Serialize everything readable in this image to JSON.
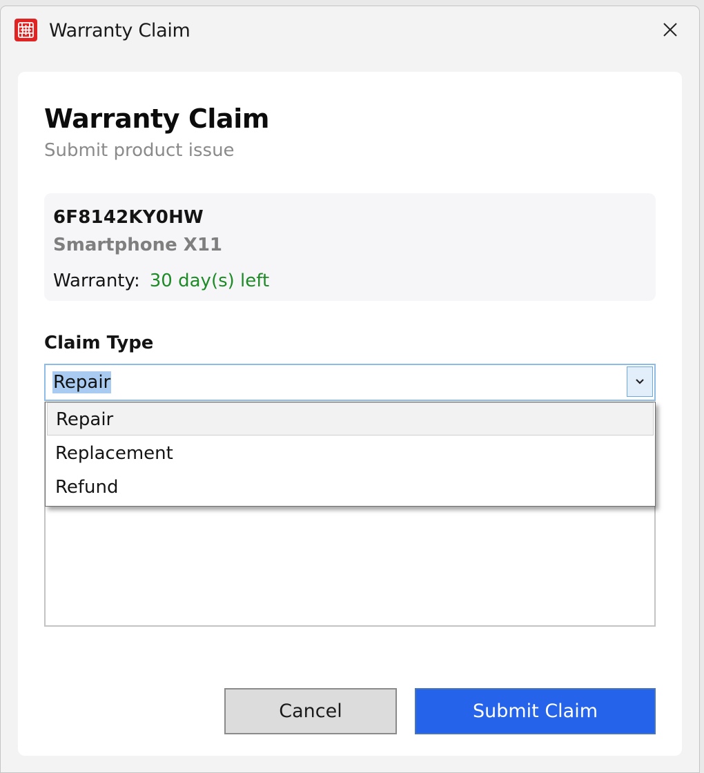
{
  "window": {
    "title": "Warranty Claim",
    "icon": "app-logo-icon",
    "close_icon": "close-icon"
  },
  "form": {
    "heading": "Warranty Claim",
    "subheading": "Submit product issue"
  },
  "product": {
    "serial": "6F8142KY0HW",
    "model": "Smartphone X11",
    "warranty_label": "Warranty:",
    "warranty_value": "30 day(s) left"
  },
  "claim": {
    "label": "Claim Type",
    "selected": "Repair",
    "options": [
      "Repair",
      "Replacement",
      "Refund"
    ]
  },
  "buttons": {
    "cancel": "Cancel",
    "submit": "Submit Claim"
  },
  "colors": {
    "accent": "#2563eb",
    "warranty_ok": "#1e8a28",
    "app_icon": "#e02424"
  }
}
